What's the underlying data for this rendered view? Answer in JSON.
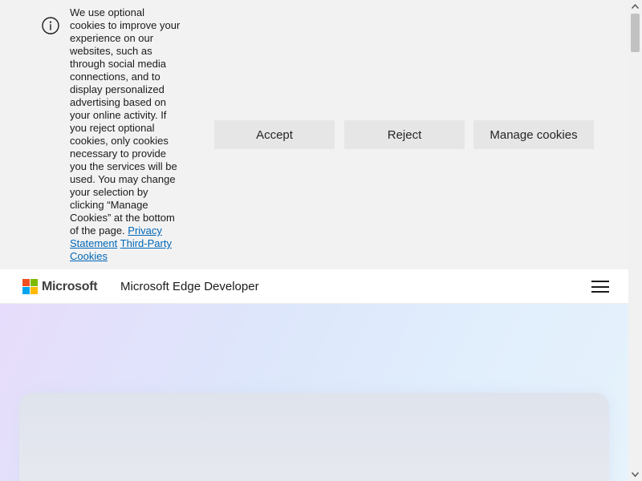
{
  "cookie_banner": {
    "message": "We use optional cookies to improve your experience on our websites, such as through social media connections, and to display personalized advertising based on your online activity. If you reject optional cookies, only cookies necessary to provide you the services will be used. You may change your selection by clicking “Manage Cookies” at the bottom of the page.",
    "privacy_link": "Privacy Statement",
    "third_party_link": "Third-Party Cookies",
    "accept_label": "Accept",
    "reject_label": "Reject",
    "manage_label": "Manage cookies"
  },
  "header": {
    "brand": "Microsoft",
    "site_title": "Microsoft Edge Developer",
    "logo_colors": [
      "#f25022",
      "#7fba00",
      "#00a4ef",
      "#ffb900"
    ]
  },
  "icons": {
    "info": "info-icon",
    "menu": "hamburger-icon"
  }
}
